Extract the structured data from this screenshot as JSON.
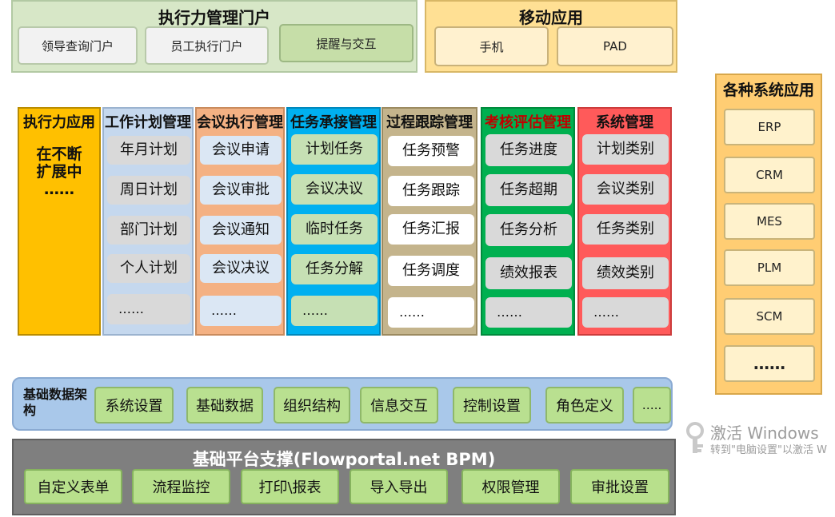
{
  "portal": {
    "title": "执行力管理门户",
    "items": [
      "领导查询门户",
      "员工执行门户",
      "提醒与交互"
    ]
  },
  "mobile": {
    "title": "移动应用",
    "items": [
      "手机",
      "PAD"
    ]
  },
  "exec_app": {
    "title": "执行力应用",
    "body_line1": "在不断",
    "body_line2": "扩展中",
    "body_line3": "……"
  },
  "columns": [
    {
      "title": "工作计划管理",
      "items": [
        "年月计划",
        "周日计划",
        "部门计划",
        "个人计划",
        "……"
      ]
    },
    {
      "title": "会议执行管理",
      "items": [
        "会议申请",
        "会议审批",
        "会议通知",
        "会议决议",
        "……"
      ]
    },
    {
      "title": "任务承接管理",
      "items": [
        "计划任务",
        "会议决议",
        "临时任务",
        "任务分解",
        "……"
      ]
    },
    {
      "title": "过程跟踪管理",
      "items": [
        "任务预警",
        "任务跟踪",
        "任务汇报",
        "任务调度",
        "……"
      ]
    },
    {
      "title": "考核评估管理",
      "items": [
        "任务进度",
        "任务超期",
        "任务分析",
        "绩效报表",
        "……"
      ]
    },
    {
      "title": "系统管理",
      "items": [
        "计划类别",
        "会议类别",
        "任务类别",
        "绩效类别",
        "……"
      ]
    }
  ],
  "systems": {
    "title": "各种系统应用",
    "items": [
      "ERP",
      "CRM",
      "MES",
      "PLM",
      "SCM",
      "……"
    ]
  },
  "basic": {
    "title": "基础数据架构",
    "items": [
      "系统设置",
      "基础数据",
      "组织结构",
      "信息交互",
      "控制设置",
      "角色定义",
      "….."
    ]
  },
  "platform": {
    "title": "基础平台支撑(Flowportal.net BPM)",
    "items": [
      "自定义表单",
      "流程监控",
      "打印\\报表",
      "导入导出",
      "权限管理",
      "审批设置"
    ]
  },
  "watermark": {
    "line1": "激活 Windows",
    "line2": "转到\"电脑设置\"以激活 W"
  },
  "colors": {
    "exec_app": "#ffc000",
    "plan": "#c5d8ee",
    "meeting": "#f4b183",
    "task": "#00b0f0",
    "process": "#c4b48c",
    "assess": "#00b050",
    "system": "#ff5a5a"
  }
}
